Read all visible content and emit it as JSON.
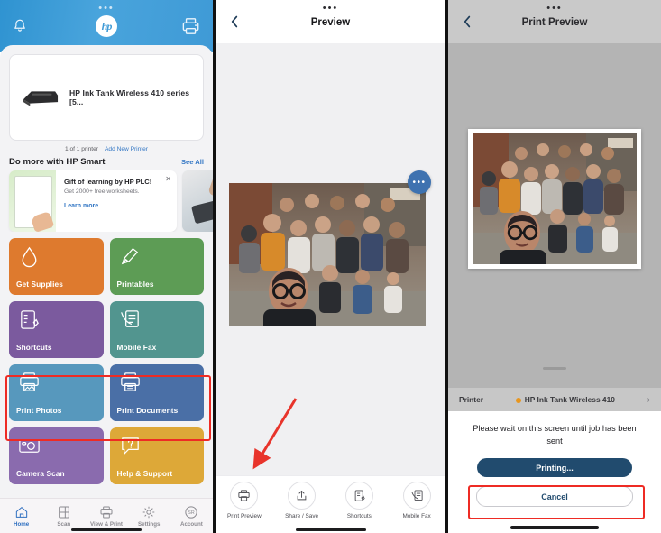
{
  "panel1": {
    "header": {
      "bell_icon": "bell-icon",
      "logo": "hp",
      "printer_icon": "printer-icon",
      "status_dots": "•••"
    },
    "printer_card": {
      "name": "HP Ink Tank Wireless 410 series [5...",
      "count_label": "1 of 1 printer",
      "add_printer_label": "Add New Printer"
    },
    "section": {
      "title": "Do more with HP Smart",
      "see_all": "See All"
    },
    "promo": {
      "title": "Gift of learning by HP PLC!",
      "subtitle": "Get 2000+ free worksheets.",
      "link": "Learn more",
      "close_icon": "close-icon"
    },
    "tiles": [
      {
        "label": "Get Supplies",
        "color": "#DE7A2E",
        "icon": "droplet-icon"
      },
      {
        "label": "Printables",
        "color": "#5D9C55",
        "icon": "printables-icon"
      },
      {
        "label": "Shortcuts",
        "color": "#7B5A9E",
        "icon": "shortcuts-icon"
      },
      {
        "label": "Mobile Fax",
        "color": "#52958F",
        "icon": "fax-icon"
      },
      {
        "label": "Print Photos",
        "color": "#5798BD",
        "icon": "print-photo-icon"
      },
      {
        "label": "Print Documents",
        "color": "#4A6FA6",
        "icon": "print-doc-icon"
      },
      {
        "label": "Camera Scan",
        "color": "#8A6BAE",
        "icon": "camera-icon"
      },
      {
        "label": "Help & Support",
        "color": "#DDA838",
        "icon": "question-icon"
      }
    ],
    "tabs": [
      {
        "label": "Home",
        "icon": "home-icon",
        "active": true
      },
      {
        "label": "Scan",
        "icon": "scan-icon",
        "active": false
      },
      {
        "label": "View & Print",
        "icon": "printer-icon",
        "active": false
      },
      {
        "label": "Settings",
        "icon": "gear-icon",
        "active": false
      },
      {
        "label": "Account",
        "icon": "avatar-icon",
        "active": false,
        "initials": "SR"
      }
    ]
  },
  "panel2": {
    "status_dots": "•••",
    "back_icon": "chevron-left-icon",
    "title": "Preview",
    "fab_label": "•••",
    "toolbar": [
      {
        "label": "Print Preview",
        "icon": "printer-icon"
      },
      {
        "label": "Share / Save",
        "icon": "share-icon"
      },
      {
        "label": "Shortcuts",
        "icon": "shortcuts-icon"
      },
      {
        "label": "Mobile Fax",
        "icon": "fax-icon"
      }
    ]
  },
  "panel3": {
    "status_dots": "•••",
    "back_icon": "chevron-left-icon",
    "title": "Print Preview",
    "printer_row": {
      "label": "Printer",
      "value": "HP Ink Tank Wireless 410",
      "status_color": "#E8961E",
      "chevron_icon": "chevron-right-icon"
    },
    "wait_message": "Please wait on this screen until job has been sent",
    "primary_button": "Printing...",
    "secondary_button": "Cancel"
  },
  "annotations": {
    "highlight_color": "#EE2B24"
  }
}
